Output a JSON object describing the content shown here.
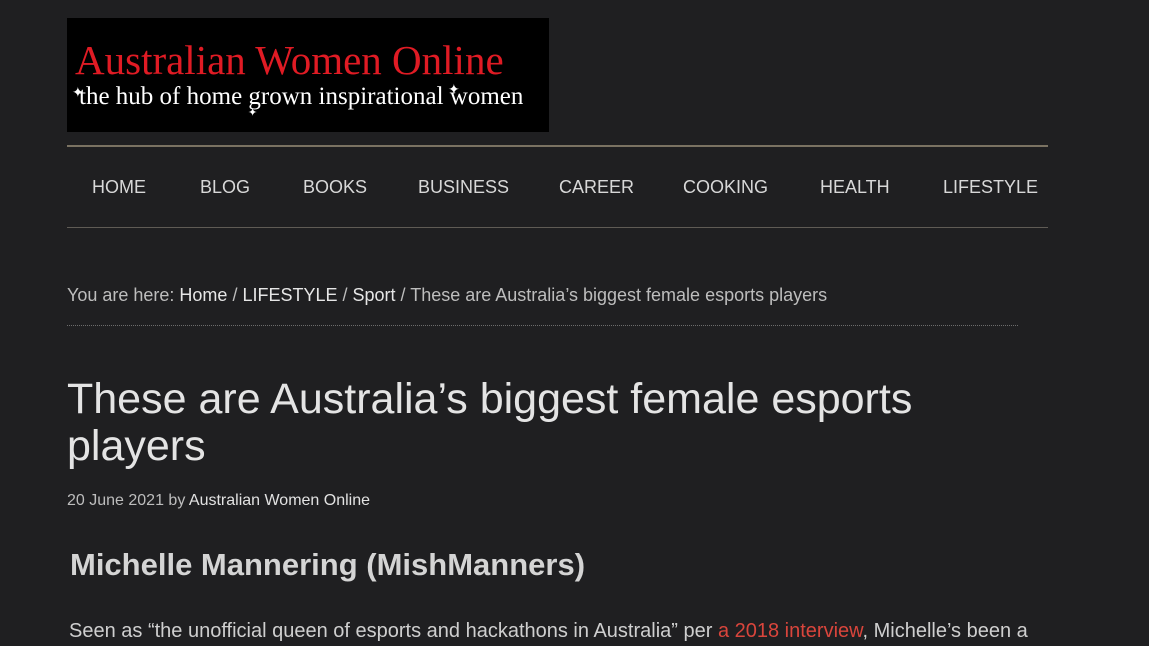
{
  "logo": {
    "title": "Australian Women Online",
    "tagline": "the hub of home grown inspirational women",
    "title_color": "#e01b24"
  },
  "nav": {
    "items": [
      "HOME",
      "BLOG",
      "BOOKS",
      "BUSINESS",
      "CAREER",
      "COOKING",
      "HEALTH",
      "LIFESTYLE"
    ]
  },
  "breadcrumb": {
    "prefix": "You are here: ",
    "home": "Home",
    "section": "LIFESTYLE",
    "category": "Sport",
    "separator": " / ",
    "current": "These are Australia’s biggest female esports players"
  },
  "post": {
    "title": "These are Australia’s biggest female esports players",
    "date": "20 June 2021",
    "by": " by ",
    "author": "Australian Women Online",
    "subheading": "Michelle Mannering (MishManners)",
    "body_before": "Seen as “the unofficial queen of esports and hackathons in Australia” per ",
    "body_link": "a 2018 interview",
    "body_after": ", Michelle’s been a",
    "link_color": "#d9453c"
  }
}
